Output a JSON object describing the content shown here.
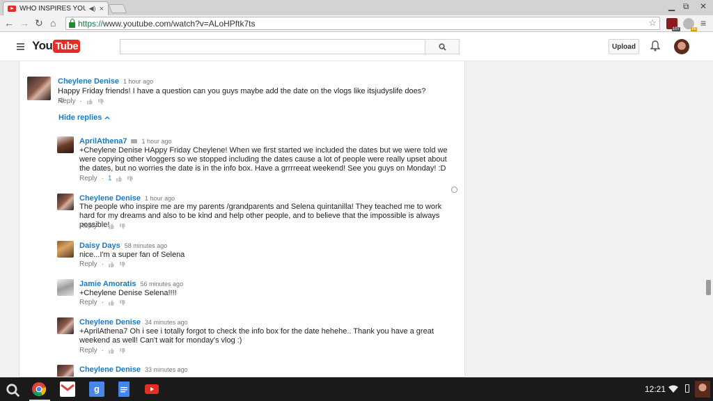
{
  "browser": {
    "tab_title": "WHO INSPIRES YOU",
    "url_scheme": "https://",
    "url_rest": "www.youtube.com/watch?v=ALoHPftk7ts",
    "ext_badge_1": "107",
    "ext_badge_2": "86"
  },
  "header": {
    "logo_you": "You",
    "logo_tube": "Tube",
    "search_placeholder": "",
    "upload_label": "Upload"
  },
  "top_comment": {
    "author": "Cheylene Denise",
    "time": "1 hour ago",
    "text": "Happy Friday friends! I have a question can you guys maybe add the date on the vlogs like itsjudyslife does?☺",
    "reply_label": "Reply",
    "hide_replies_label": "Hide replies"
  },
  "replies": [
    {
      "author": "AprilAthena7",
      "time": "1 hour ago",
      "text": "+Cheylene Denise HAppy Friday Cheylene!  When we first started we included the dates but we were told we were copying other vloggers so we stopped including the dates cause a lot of people were really upset about the dates, but no worries the date is in the info box.  Have a grrrreeat weekend!  See you guys on Monday! :D",
      "reply_label": "Reply",
      "likes": "1"
    },
    {
      "author": "Cheylene Denise",
      "time": "1 hour ago",
      "text": "The people who inspire me are my parents /grandparents and Selena quintanilla! They teached me to work hard for my dreams and also to be kind and help other people, and to believe that the impossible is always possible!",
      "reply_label": "Reply"
    },
    {
      "author": "Daisy Days",
      "time": "58 minutes ago",
      "text": "nice...I'm a super fan of Selena",
      "reply_label": "Reply"
    },
    {
      "author": "Jamie Amoratis",
      "time": "56 minutes ago",
      "text": "+Cheylene Denise Selena!!!!",
      "reply_label": "Reply"
    },
    {
      "author": "Cheylene Denise",
      "time": "34 minutes ago",
      "text": "+AprilAthena7 Oh i see i totally forgot to check the info box for the date hehehe.. Thank you have a great weekend as well! Can't wait for monday's vlog :)",
      "reply_label": "Reply"
    },
    {
      "author": "Cheylene Denise",
      "time": "33 minutes ago",
      "text": "",
      "reply_label": ""
    }
  ],
  "shelf": {
    "clock": "12:21"
  },
  "colors": {
    "link_blue": "#167ac6",
    "youtube_red": "#e52d27"
  }
}
